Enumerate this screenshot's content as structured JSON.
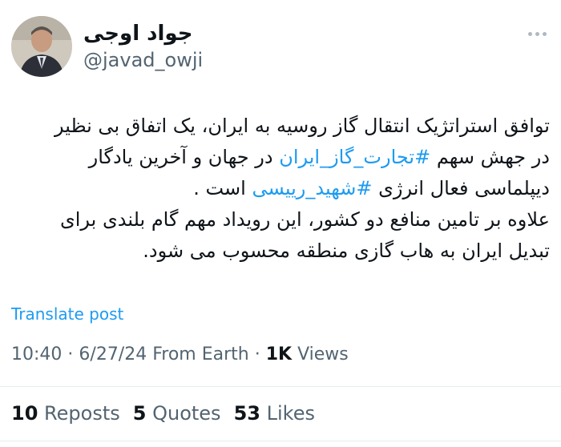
{
  "author": {
    "display_name": "جواد اوجی",
    "handle": "@javad_owji"
  },
  "tweet": {
    "line1": "توافق استراتژیک انتقال گاز روسیه به ایران، یک اتفاق بی نظیر",
    "line2_pre": "در جهش سهم ",
    "line2_hashtag": "#تجارت_گاز_ایران",
    "line2_post": " در جهان و آخرین یادگار",
    "line3_pre": "دیپلماسی فعال انرژی ",
    "line3_hashtag": "#شهید_رییسی",
    "line3_post": " است .",
    "line4": "علاوه بر تامین منافع دو کشور، این رویداد مهم گام بلندی برای",
    "line5": "تبدیل ایران به هاب گازی منطقه محسوب می شود."
  },
  "translate_label": "Translate post",
  "meta": {
    "time": "10:40",
    "date": "6/27/24",
    "source": "From Earth",
    "views_count": "1K",
    "views_label": "Views"
  },
  "stats": {
    "reposts_count": "10",
    "reposts_label": "Reposts",
    "quotes_count": "5",
    "quotes_label": "Quotes",
    "likes_count": "53",
    "likes_label": "Likes"
  },
  "colors": {
    "link": "#1d9bf0",
    "secondary": "#536471",
    "primary": "#0f1419"
  },
  "icons": {
    "more": "more-horizontal-icon"
  }
}
